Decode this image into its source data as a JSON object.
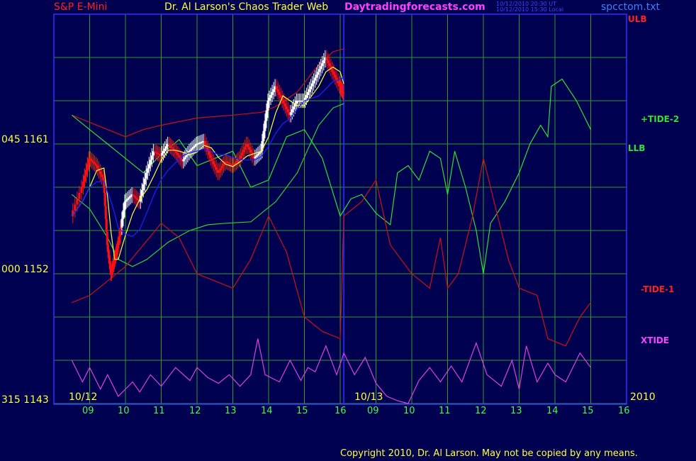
{
  "header": {
    "left_title": "S&P E-Mini",
    "center_title": "Dr. Al Larson's Chaos Trader Web",
    "site": "Daytradingforecasts.com",
    "stamp_ut": "10/12/2010 20:30 UT",
    "stamp_local": "10/12/2010 15:30 Local",
    "file": "spcctom.txt"
  },
  "y_axis_labels": [
    "045  1161",
    "000  1152",
    "315  1143"
  ],
  "right_labels": {
    "ulb": "ULB",
    "tide2": "+TIDE-2",
    "llb": "LLB",
    "tide1": "-TIDE-1",
    "xtide": "XTIDE"
  },
  "date_labels": {
    "day1": "10/12",
    "day2": "10/13",
    "year": "2010"
  },
  "x_tick_labels": [
    "09",
    "10",
    "11",
    "12",
    "13",
    "14",
    "15",
    "16",
    "09",
    "10",
    "11",
    "12",
    "13",
    "14",
    "15",
    "16"
  ],
  "copyright": "Copyright 2010, Dr. Al Larson. May not be copied by any means.",
  "colors": {
    "background": "#000050",
    "grid": "#2e9a2e",
    "frame": "#3030ff",
    "ulb": "#d01010",
    "llb": "#30d030",
    "tide2": "#30e030",
    "tide1": "#d01010",
    "xtide": "#e040e0",
    "price_up": "#ffffff",
    "price_down": "#ff1010",
    "avg_fast": "#ffff40",
    "avg_slow": "#2020ff"
  },
  "chart_data": {
    "type": "line",
    "y_price_range": [
      1140.0,
      1168.0
    ],
    "x_hours_day1": [
      "09",
      "10",
      "11",
      "12",
      "13",
      "14",
      "15",
      "16"
    ],
    "x_hours_day2": [
      "09",
      "10",
      "11",
      "12",
      "13",
      "14",
      "15",
      "16"
    ],
    "price_close": [
      [
        8.5,
        1156.0
      ],
      [
        8.8,
        1158.0
      ],
      [
        9.0,
        1160.0
      ],
      [
        9.2,
        1159.5
      ],
      [
        9.4,
        1158.5
      ],
      [
        9.5,
        1154.0
      ],
      [
        9.6,
        1152.0
      ],
      [
        9.7,
        1153.0
      ],
      [
        9.8,
        1154.0
      ],
      [
        10.0,
        1157.0
      ],
      [
        10.2,
        1157.5
      ],
      [
        10.4,
        1157.0
      ],
      [
        10.6,
        1159.0
      ],
      [
        10.8,
        1160.5
      ],
      [
        11.0,
        1160.2
      ],
      [
        11.2,
        1161.0
      ],
      [
        11.4,
        1160.5
      ],
      [
        11.6,
        1159.8
      ],
      [
        11.8,
        1160.5
      ],
      [
        12.0,
        1161.0
      ],
      [
        12.2,
        1161.2
      ],
      [
        12.4,
        1160.0
      ],
      [
        12.6,
        1159.0
      ],
      [
        12.8,
        1159.8
      ],
      [
        13.0,
        1159.5
      ],
      [
        13.2,
        1160.0
      ],
      [
        13.4,
        1161.0
      ],
      [
        13.6,
        1160.0
      ],
      [
        13.8,
        1160.5
      ],
      [
        14.0,
        1164.0
      ],
      [
        14.2,
        1165.0
      ],
      [
        14.4,
        1164.0
      ],
      [
        14.6,
        1163.0
      ],
      [
        14.8,
        1164.0
      ],
      [
        15.0,
        1164.0
      ],
      [
        15.2,
        1165.0
      ],
      [
        15.4,
        1166.0
      ],
      [
        15.6,
        1167.0
      ],
      [
        15.8,
        1166.0
      ],
      [
        16.0,
        1165.0
      ],
      [
        16.1,
        1164.5
      ]
    ],
    "series": [
      {
        "name": "ULB",
        "values": [
          [
            8.5,
            1163.0
          ],
          [
            9.0,
            1162.5
          ],
          [
            9.5,
            1162.0
          ],
          [
            10.0,
            1161.5
          ],
          [
            10.5,
            1162.0
          ],
          [
            11.0,
            1162.3
          ],
          [
            12.0,
            1162.8
          ],
          [
            13.0,
            1163.0
          ],
          [
            13.8,
            1163.2
          ],
          [
            14.2,
            1163.6
          ],
          [
            14.8,
            1164.6
          ],
          [
            15.4,
            1166.5
          ],
          [
            15.8,
            1167.4
          ],
          [
            16.1,
            1167.6
          ]
        ]
      },
      {
        "name": "LLB",
        "values": [
          [
            8.5,
            1157.5
          ],
          [
            9.0,
            1156.5
          ],
          [
            9.5,
            1154.5
          ],
          [
            9.8,
            1153.0
          ],
          [
            10.2,
            1152.5
          ],
          [
            10.6,
            1153.0
          ],
          [
            11.2,
            1154.2
          ],
          [
            11.8,
            1155.0
          ],
          [
            12.3,
            1155.4
          ],
          [
            12.8,
            1155.5
          ],
          [
            13.5,
            1155.6
          ],
          [
            14.2,
            1157.0
          ],
          [
            14.8,
            1159.0
          ],
          [
            15.4,
            1162.3
          ],
          [
            15.8,
            1163.5
          ],
          [
            16.1,
            1163.8
          ]
        ]
      },
      {
        "name": "+TIDE-2",
        "values": [
          [
            8.5,
            1163.0
          ],
          [
            9.0,
            1162.0
          ],
          [
            9.5,
            1161.0
          ],
          [
            10.0,
            1160.0
          ],
          [
            10.5,
            1159.0
          ],
          [
            11.0,
            1160.3
          ],
          [
            11.5,
            1161.3
          ],
          [
            12.0,
            1159.5
          ],
          [
            12.5,
            1160.0
          ],
          [
            13.0,
            1160.5
          ],
          [
            13.5,
            1158.0
          ],
          [
            14.0,
            1158.5
          ],
          [
            14.5,
            1161.5
          ],
          [
            15.0,
            1162.0
          ],
          [
            15.5,
            1160.0
          ],
          [
            16.0,
            1156.0
          ],
          [
            16.3,
            1157.2
          ],
          [
            16.6,
            1157.5
          ],
          [
            17.0,
            1156.2
          ],
          [
            17.4,
            1155.4
          ],
          [
            17.6,
            1159.0
          ],
          [
            17.9,
            1159.5
          ],
          [
            18.2,
            1158.5
          ],
          [
            18.5,
            1160.5
          ],
          [
            18.8,
            1160.0
          ],
          [
            19.0,
            1157.5
          ],
          [
            19.2,
            1160.5
          ],
          [
            19.5,
            1158.0
          ],
          [
            19.8,
            1155.0
          ],
          [
            20.0,
            1152.0
          ],
          [
            20.2,
            1155.5
          ],
          [
            20.6,
            1157.0
          ],
          [
            21.0,
            1159.0
          ],
          [
            21.3,
            1161.0
          ],
          [
            21.6,
            1162.3
          ],
          [
            21.8,
            1161.5
          ],
          [
            21.9,
            1165.0
          ],
          [
            22.2,
            1165.5
          ],
          [
            22.6,
            1164.0
          ],
          [
            23.0,
            1162.0
          ]
        ]
      },
      {
        "name": "-TIDE-1",
        "values": [
          [
            8.5,
            1150.0
          ],
          [
            9.0,
            1150.5
          ],
          [
            9.5,
            1151.5
          ],
          [
            10.0,
            1152.5
          ],
          [
            10.5,
            1154.0
          ],
          [
            11.0,
            1155.5
          ],
          [
            11.5,
            1154.5
          ],
          [
            12.0,
            1152.0
          ],
          [
            12.5,
            1151.5
          ],
          [
            13.0,
            1151.0
          ],
          [
            13.5,
            1153.0
          ],
          [
            14.0,
            1156.0
          ],
          [
            14.5,
            1153.5
          ],
          [
            15.0,
            1149.0
          ],
          [
            15.5,
            1148.0
          ],
          [
            16.0,
            1147.5
          ],
          [
            16.1,
            1156.0
          ],
          [
            16.6,
            1157.0
          ],
          [
            17.0,
            1158.5
          ],
          [
            17.4,
            1154.0
          ],
          [
            17.7,
            1153.0
          ],
          [
            18.0,
            1152.0
          ],
          [
            18.5,
            1151.0
          ],
          [
            18.8,
            1154.5
          ],
          [
            19.0,
            1151.0
          ],
          [
            19.3,
            1152.0
          ],
          [
            19.7,
            1156.0
          ],
          [
            20.0,
            1160.0
          ],
          [
            20.2,
            1158.0
          ],
          [
            20.7,
            1153.0
          ],
          [
            21.0,
            1151.0
          ],
          [
            21.5,
            1150.5
          ],
          [
            21.8,
            1147.5
          ],
          [
            22.3,
            1147.0
          ],
          [
            22.7,
            1149.0
          ],
          [
            23.0,
            1150.0
          ]
        ]
      },
      {
        "name": "XTIDE",
        "values": [
          [
            8.5,
            1146.0
          ],
          [
            8.8,
            1144.5
          ],
          [
            9.0,
            1145.5
          ],
          [
            9.3,
            1144.0
          ],
          [
            9.5,
            1145.0
          ],
          [
            9.8,
            1143.5
          ],
          [
            10.2,
            1144.5
          ],
          [
            10.4,
            1143.8
          ],
          [
            10.7,
            1145.0
          ],
          [
            11.0,
            1144.2
          ],
          [
            11.4,
            1145.5
          ],
          [
            11.8,
            1144.6
          ],
          [
            12.0,
            1145.5
          ],
          [
            12.3,
            1144.8
          ],
          [
            12.6,
            1144.4
          ],
          [
            12.9,
            1145.0
          ],
          [
            13.2,
            1144.2
          ],
          [
            13.5,
            1145.0
          ],
          [
            13.7,
            1147.5
          ],
          [
            13.9,
            1145.0
          ],
          [
            14.3,
            1144.5
          ],
          [
            14.6,
            1146.0
          ],
          [
            14.9,
            1144.6
          ],
          [
            15.1,
            1145.5
          ],
          [
            15.3,
            1145.2
          ],
          [
            15.6,
            1147.0
          ],
          [
            15.9,
            1145.0
          ],
          [
            16.1,
            1146.5
          ],
          [
            16.4,
            1145.0
          ],
          [
            16.7,
            1146.2
          ],
          [
            17.0,
            1144.4
          ],
          [
            17.3,
            1143.5
          ],
          [
            17.6,
            1143.2
          ],
          [
            17.9,
            1143.0
          ],
          [
            18.2,
            1144.6
          ],
          [
            18.5,
            1145.5
          ],
          [
            18.8,
            1144.5
          ],
          [
            19.1,
            1145.6
          ],
          [
            19.4,
            1144.5
          ],
          [
            19.8,
            1147.2
          ],
          [
            20.1,
            1145.0
          ],
          [
            20.5,
            1144.2
          ],
          [
            20.8,
            1146.0
          ],
          [
            21.0,
            1144.0
          ],
          [
            21.2,
            1147.0
          ],
          [
            21.5,
            1144.5
          ],
          [
            21.8,
            1145.8
          ],
          [
            22.0,
            1145.0
          ],
          [
            22.3,
            1144.5
          ],
          [
            22.7,
            1146.5
          ],
          [
            23.0,
            1145.5
          ]
        ]
      }
    ]
  }
}
